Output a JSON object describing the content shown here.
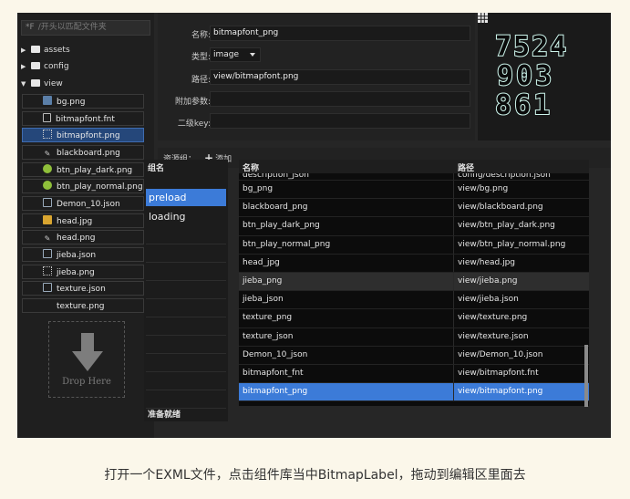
{
  "search": {
    "prefix": "*F",
    "placeholder": "/开头以匹配文件夹"
  },
  "tree": {
    "folders": [
      {
        "label": "assets",
        "expanded": false
      },
      {
        "label": "config",
        "expanded": false
      },
      {
        "label": "view",
        "expanded": true
      }
    ],
    "files": [
      {
        "label": "bg.png",
        "icon": "image-icon"
      },
      {
        "label": "bitmapfont.fnt",
        "icon": "text-file-icon"
      },
      {
        "label": "bitmapfont.png",
        "icon": "bitmapfont-icon",
        "selected": true
      },
      {
        "label": "blackboard.png",
        "icon": "pen-icon"
      },
      {
        "label": "btn_play_dark.png",
        "icon": "play-button-icon"
      },
      {
        "label": "btn_play_normal.png",
        "icon": "play-button-icon"
      },
      {
        "label": "Demon_10.json",
        "icon": "json-icon"
      },
      {
        "label": "head.jpg",
        "icon": "image-icon"
      },
      {
        "label": "head.png",
        "icon": "image-icon"
      },
      {
        "label": "jieba.json",
        "icon": "json-icon"
      },
      {
        "label": "jieba.png",
        "icon": "grid-image-icon"
      },
      {
        "label": "texture.json",
        "icon": "json-icon"
      },
      {
        "label": "texture.png",
        "icon": "none"
      }
    ],
    "drop_label": "Drop Here"
  },
  "props": {
    "name_label": "名称:",
    "name_value": "bitmapfont_png",
    "type_label": "类型:",
    "type_value": "image",
    "path_label": "路径:",
    "path_value": "view/bitmapfont.png",
    "params_label": "附加参数:",
    "params_value": "",
    "subkey_label": "二级key:",
    "subkey_value": ""
  },
  "preview": {
    "lines": [
      "7524",
      "903",
      "861"
    ]
  },
  "resource_groups": {
    "label": "资源组：",
    "add_label": "添加",
    "group_header": "组名",
    "groups": [
      "preload",
      "loading"
    ],
    "selected_group": "preload",
    "status": "准备就绪"
  },
  "table": {
    "col_name": "名称",
    "col_path": "路径",
    "partial_row": {
      "name": "description_json",
      "path": "config/description.json"
    },
    "rows": [
      {
        "name": "bg_png",
        "path": "view/bg.png"
      },
      {
        "name": "blackboard_png",
        "path": "view/blackboard.png"
      },
      {
        "name": "btn_play_dark_png",
        "path": "view/btn_play_dark.png"
      },
      {
        "name": "btn_play_normal_png",
        "path": "view/btn_play_normal.png"
      },
      {
        "name": "head_jpg",
        "path": "view/head.jpg"
      },
      {
        "name": "jieba_png",
        "path": "view/jieba.png",
        "highlight": true
      },
      {
        "name": "jieba_json",
        "path": "view/jieba.json"
      },
      {
        "name": "texture_png",
        "path": "view/texture.png"
      },
      {
        "name": "texture_json",
        "path": "view/texture.json"
      },
      {
        "name": "Demon_10_json",
        "path": "view/Demon_10.json"
      },
      {
        "name": "bitmapfont_fnt",
        "path": "view/bitmapfont.fnt"
      },
      {
        "name": "bitmapfont_png",
        "path": "view/bitmapfont.png",
        "selected": true
      }
    ]
  },
  "caption": "打开一个EXML文件，点击组件库当中BitmapLabel，拖动到编辑区里面去",
  "colors": {
    "selection": "#3c7bd8",
    "panel": "#262626",
    "page_bg": "#fbf7ea"
  }
}
